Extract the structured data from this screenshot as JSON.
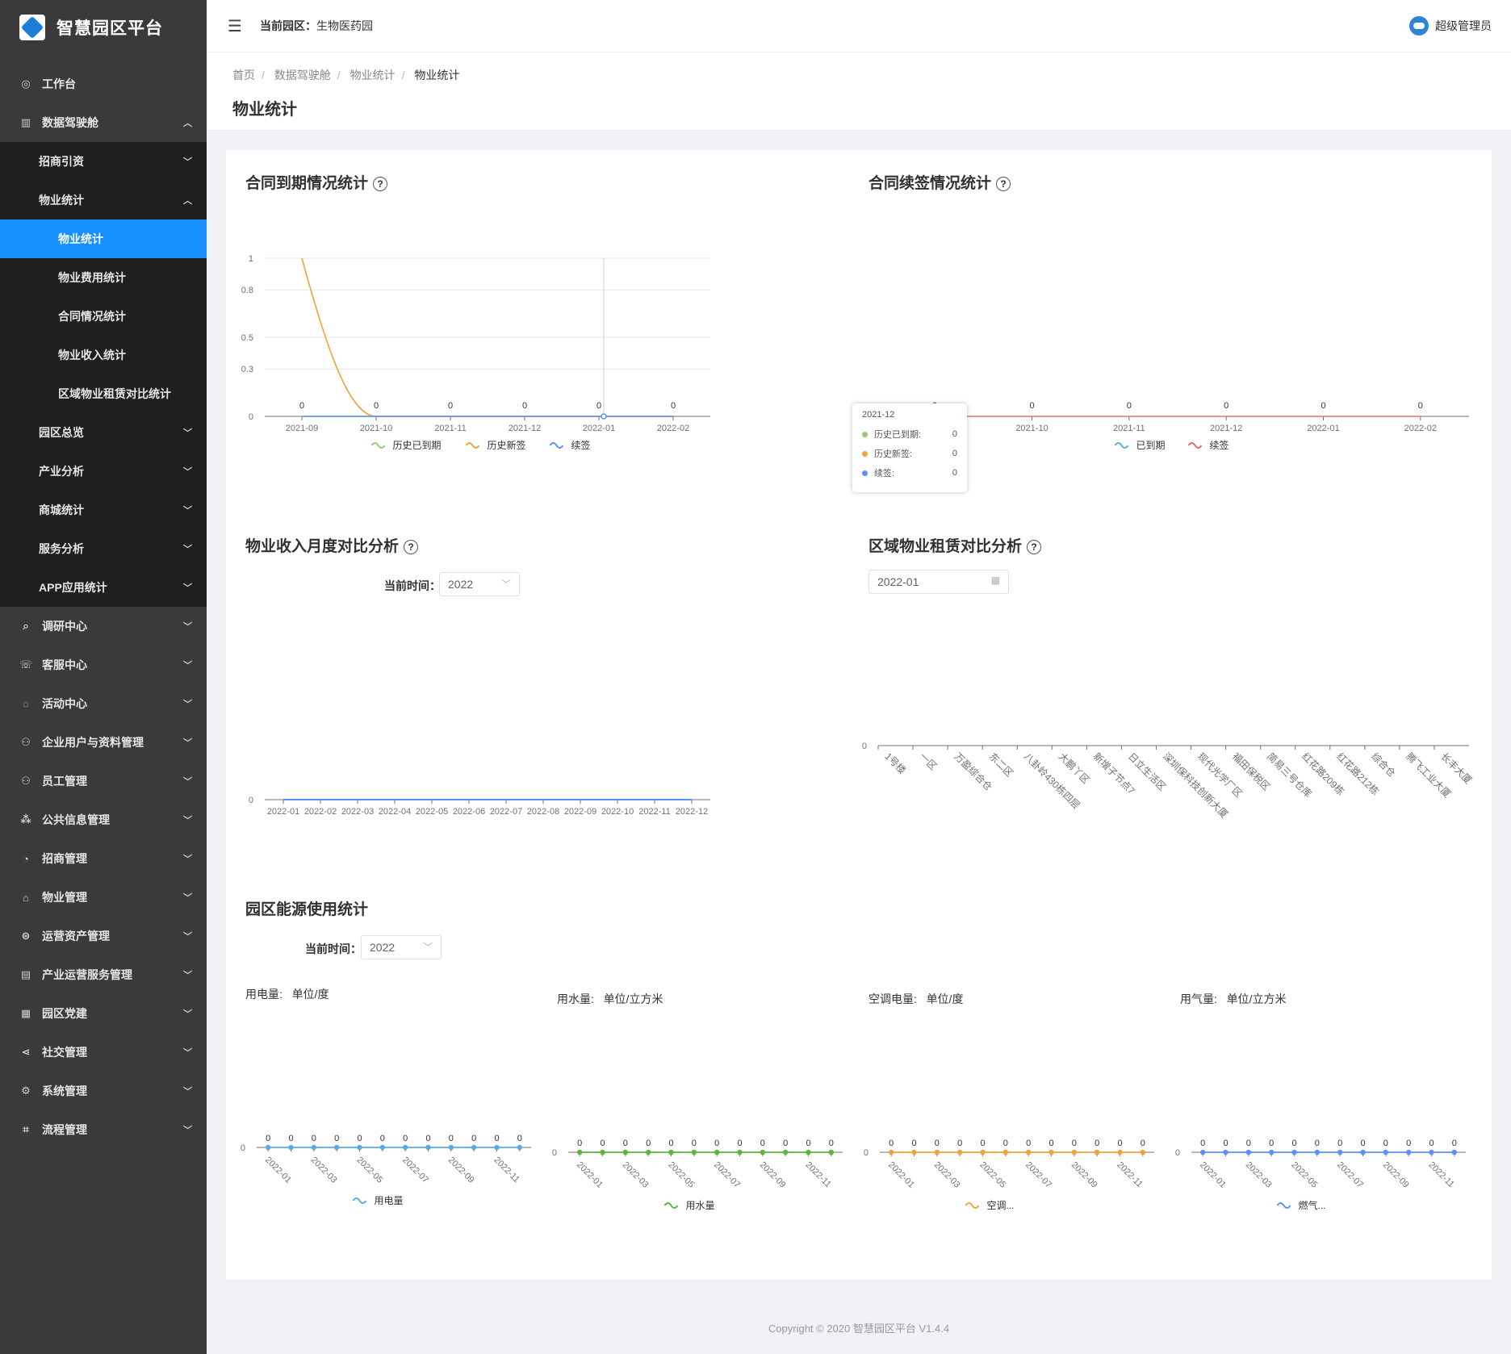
{
  "app": {
    "title": "智慧园区平台"
  },
  "header": {
    "park_label": "当前园区：",
    "park_name": "生物医药园",
    "user": "超级管理员"
  },
  "sidebar": {
    "items": [
      {
        "label": "工作台",
        "icon": "dashboard-icon"
      },
      {
        "label": "数据驾驶舱",
        "icon": "bar-chart-icon",
        "expanded": true
      },
      {
        "label": "招商引资"
      },
      {
        "label": "物业统计",
        "expanded": true
      },
      {
        "label": "物业统计",
        "active": true
      },
      {
        "label": "物业费用统计"
      },
      {
        "label": "合同情况统计"
      },
      {
        "label": "物业收入统计"
      },
      {
        "label": "区域物业租赁对比统计"
      },
      {
        "label": "园区总览"
      },
      {
        "label": "产业分析"
      },
      {
        "label": "商城统计"
      },
      {
        "label": "服务分析"
      },
      {
        "label": "APP应用统计"
      },
      {
        "label": "调研中心",
        "icon": "search-icon"
      },
      {
        "label": "客服中心",
        "icon": "headset-icon"
      },
      {
        "label": "活动中心",
        "icon": "activity-icon"
      },
      {
        "label": "企业用户与资料管理",
        "icon": "users-icon"
      },
      {
        "label": "员工管理",
        "icon": "user-icon"
      },
      {
        "label": "公共信息管理",
        "icon": "tree-icon"
      },
      {
        "label": "招商管理",
        "icon": "pie-icon"
      },
      {
        "label": "物业管理",
        "icon": "home-icon"
      },
      {
        "label": "运营资产管理",
        "icon": "coin-icon"
      },
      {
        "label": "产业运营服务管理",
        "icon": "doc-icon"
      },
      {
        "label": "园区党建",
        "icon": "building-icon"
      },
      {
        "label": "社交管理",
        "icon": "share-icon"
      },
      {
        "label": "系统管理",
        "icon": "gear-icon"
      },
      {
        "label": "流程管理",
        "icon": "flow-icon"
      }
    ]
  },
  "breadcrumb": [
    "首页",
    "数据驾驶舱",
    "物业统计",
    "物业统计"
  ],
  "page_title": "物业统计",
  "sections": {
    "expire": "合同到期情况统计",
    "renew": "合同续签情况统计",
    "income": "物业收入月度对比分析",
    "region": "区域物业租赁对比分析",
    "energy": "园区能源使用统计"
  },
  "filters": {
    "time_label": "当前时间：",
    "income_year": "2022",
    "region_month": "2022-01",
    "energy_year": "2022"
  },
  "tooltip": {
    "title": "2021-12",
    "rows": [
      {
        "label": "历史已到期:",
        "value": "0",
        "color": "#91cc75"
      },
      {
        "label": "历史新签:",
        "value": "0",
        "color": "#fac858"
      },
      {
        "label": "续签:",
        "value": "0",
        "color": "#5470c6"
      }
    ]
  },
  "chart_data": [
    {
      "type": "line",
      "title": "合同到期情况统计",
      "x": [
        "2021-09",
        "2021-10",
        "2021-11",
        "2021-12",
        "2022-01",
        "2022-02"
      ],
      "ylim": [
        0,
        1
      ],
      "yticks": [
        "1",
        "0.8",
        "0.5",
        "0.3",
        "0"
      ],
      "series": [
        {
          "name": "历史已到期",
          "values": [
            0,
            0,
            0,
            0,
            0,
            0
          ],
          "color": "#91cc75"
        },
        {
          "name": "历史新签",
          "values": [
            1,
            0,
            0,
            0,
            0,
            0
          ],
          "color": "#f0a33a"
        },
        {
          "name": "续签",
          "values": [
            0,
            0,
            0,
            0,
            0,
            0
          ],
          "color": "#5b8ff9"
        }
      ],
      "data_labels": [
        "0",
        "0",
        "0",
        "0",
        "0",
        "0"
      ]
    },
    {
      "type": "line",
      "title": "合同续签情况统计",
      "x": [
        "2021-09",
        "2021-10",
        "2021-11",
        "2021-12",
        "2022-01",
        "2022-02"
      ],
      "yticks": [
        "0"
      ],
      "series": [
        {
          "name": "已到期",
          "values": [
            0,
            0,
            0,
            0,
            0,
            0
          ],
          "color": "#5aa9e6"
        },
        {
          "name": "续签",
          "values": [
            0,
            0,
            0,
            0,
            0,
            0
          ],
          "color": "#ee6666"
        }
      ],
      "data_labels": [
        "0",
        "0",
        "0",
        "0",
        "0",
        "0"
      ]
    },
    {
      "type": "line",
      "title": "物业收入月度对比分析",
      "x": [
        "2022-01",
        "2022-02",
        "2022-03",
        "2022-04",
        "2022-05",
        "2022-06",
        "2022-07",
        "2022-08",
        "2022-09",
        "2022-10",
        "2022-11",
        "2022-12"
      ],
      "yticks": [
        "0"
      ],
      "series": [
        {
          "values": [
            0,
            0,
            0,
            0,
            0,
            0,
            0,
            0,
            0,
            0,
            0,
            0
          ],
          "color": "#5b8ff9"
        }
      ]
    },
    {
      "type": "bar",
      "title": "区域物业租赁对比分析",
      "categories": [
        "1号楼",
        "一区",
        "万盈综合仓",
        "东二区",
        "八卦岭430栋四层",
        "大鹏丫区",
        "新增子节点7",
        "日立生活区",
        "深圳保科技创新大厦",
        "现代光学厂区",
        "福田保税区",
        "简易三号仓库",
        "红花路209栋",
        "红花路212栋",
        "综合仓",
        "腾飞工业大厦",
        "长丰大厦"
      ],
      "yticks": [
        "0"
      ],
      "values": [
        0,
        0,
        0,
        0,
        0,
        0,
        0,
        0,
        0,
        0,
        0,
        0,
        0,
        0,
        0,
        0,
        0
      ]
    },
    {
      "type": "line",
      "title": "用电量:",
      "unit": "单位/度",
      "x": [
        "2022-01",
        "2022-02",
        "2022-03",
        "2022-04",
        "2022-05",
        "2022-06",
        "2022-07",
        "2022-08",
        "2022-09",
        "2022-10",
        "2022-11",
        "2022-12"
      ],
      "xticks": [
        "2022-01",
        "2022-03",
        "2022-05",
        "2022-07",
        "2022-09",
        "2022-11"
      ],
      "yticks": [
        "0"
      ],
      "series": [
        {
          "name": "用电量",
          "values": [
            0,
            0,
            0,
            0,
            0,
            0,
            0,
            0,
            0,
            0,
            0,
            0
          ],
          "color": "#5aa9e6"
        }
      ]
    },
    {
      "type": "line",
      "title": "用水量:",
      "unit": "单位/立方米",
      "x": [
        "2022-01",
        "2022-02",
        "2022-03",
        "2022-04",
        "2022-05",
        "2022-06",
        "2022-07",
        "2022-08",
        "2022-09",
        "2022-10",
        "2022-11",
        "2022-12"
      ],
      "xticks": [
        "2022-01",
        "2022-03",
        "2022-05",
        "2022-07",
        "2022-09",
        "2022-11"
      ],
      "yticks": [
        "0"
      ],
      "series": [
        {
          "name": "用水量",
          "values": [
            0,
            0,
            0,
            0,
            0,
            0,
            0,
            0,
            0,
            0,
            0,
            0
          ],
          "color": "#5bb539"
        }
      ]
    },
    {
      "type": "line",
      "title": "空调电量:",
      "unit": "单位/度",
      "x": [
        "2022-01",
        "2022-02",
        "2022-03",
        "2022-04",
        "2022-05",
        "2022-06",
        "2022-07",
        "2022-08",
        "2022-09",
        "2022-10",
        "2022-11",
        "2022-12"
      ],
      "xticks": [
        "2022-01",
        "2022-03",
        "2022-05",
        "2022-07",
        "2022-09",
        "2022-11"
      ],
      "yticks": [
        "0"
      ],
      "series": [
        {
          "name": "空调...",
          "values": [
            0,
            0,
            0,
            0,
            0,
            0,
            0,
            0,
            0,
            0,
            0,
            0
          ],
          "color": "#f0a33a"
        }
      ]
    },
    {
      "type": "line",
      "title": "用气量:",
      "unit": "单位/立方米",
      "x": [
        "2022-01",
        "2022-02",
        "2022-03",
        "2022-04",
        "2022-05",
        "2022-06",
        "2022-07",
        "2022-08",
        "2022-09",
        "2022-10",
        "2022-11",
        "2022-12"
      ],
      "xticks": [
        "2022-01",
        "2022-03",
        "2022-05",
        "2022-07",
        "2022-09",
        "2022-11"
      ],
      "yticks": [
        "0"
      ],
      "series": [
        {
          "name": "燃气...",
          "values": [
            0,
            0,
            0,
            0,
            0,
            0,
            0,
            0,
            0,
            0,
            0,
            0
          ],
          "color": "#5b8ff9"
        }
      ]
    }
  ],
  "footer": {
    "text": "Copyright © 2020 智慧园区平台 V1.4.4"
  }
}
